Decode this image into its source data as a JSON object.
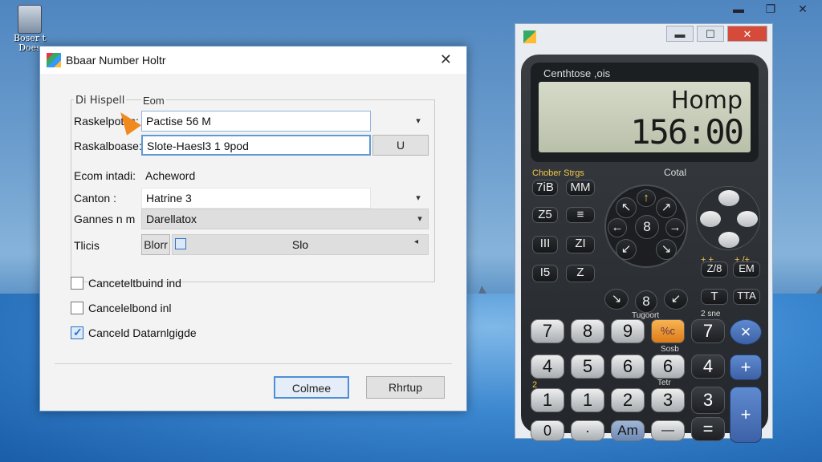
{
  "desktop": {
    "icon_label": "Boser t\nDoes"
  },
  "dialog": {
    "title": "Bbaar Number Holtr",
    "close": "✕",
    "legend1": "Di Hispell",
    "legend2": "Eom",
    "rows": [
      {
        "label": "Raskelpotes:",
        "value": "Pactise 56 M"
      },
      {
        "label": "Raskalboase:",
        "value": "Slote-Haesl3 1 9pod",
        "button": "U"
      },
      {
        "label": "Ecom intadi:",
        "value": "Acheword"
      },
      {
        "label": "Canton :",
        "value": "Hatrine 3"
      },
      {
        "label": "Gannes n m",
        "value": "Darellatox"
      },
      {
        "label": "Tlicis",
        "button": "Blorr",
        "value": "Slo"
      }
    ],
    "checks": [
      {
        "label": "Canceteltbuind ind",
        "checked": false
      },
      {
        "label": "Cancelelbond inl",
        "checked": false
      },
      {
        "label": "Canceld Datarnlgigde",
        "checked": true
      }
    ],
    "ok": "Colmee",
    "cancel": "Rhrtup"
  },
  "calc": {
    "header": "Centhtose ,ois",
    "line1": "Homp",
    "line2": "156:00",
    "lbl_left": "Chober Strgs",
    "lbl_right": "Cotal",
    "labels": {
      "a": "Tugoort",
      "b": "2 sne",
      "c": "Sosb",
      "d": "Tetr",
      "e": "7",
      "f": "2",
      "g": "7",
      "h": "+ +",
      "i": "+ /+"
    },
    "keys": {
      "r1": [
        "7iB",
        "MM"
      ],
      "r2": [
        "Z5",
        "≡"
      ],
      "r3": [
        "III",
        "ZI"
      ],
      "r4": [
        "I5",
        "Z"
      ],
      "dial": [
        "↖",
        "↗",
        "←",
        "→",
        "↓",
        "↑",
        "↙",
        "↘",
        "8"
      ],
      "sideA": [
        "Z/8",
        "EM"
      ],
      "sideB": [
        "T",
        "TTA"
      ],
      "big1": [
        "7",
        "8",
        "9",
        "%c",
        "7"
      ],
      "big2": [
        "4",
        "5",
        "6",
        "6",
        "4"
      ],
      "big3": [
        "1",
        "1",
        "2",
        "3",
        "3"
      ],
      "big4": [
        "0",
        "·",
        "Am",
        "—",
        "="
      ],
      "ops": [
        "×",
        "+",
        "+"
      ],
      "small": [
        "+",
        "/"
      ]
    }
  }
}
